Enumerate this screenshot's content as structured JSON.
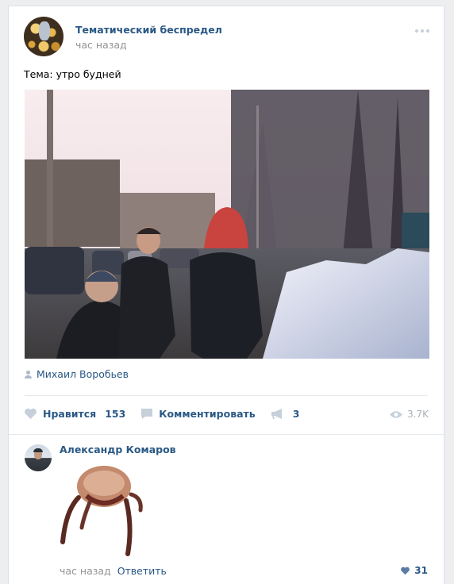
{
  "post": {
    "author": "Тематический беспредел",
    "time": "час назад",
    "text": "Тема: утро будней",
    "photo_author": "Михаил Воробьев",
    "likes_label": "Нравится",
    "likes_count": "153",
    "comment_label": "Комментировать",
    "shares_count": "3",
    "views": "3.7K"
  },
  "comment": {
    "author": "Александр Комаров",
    "time": "час назад",
    "reply_label": "Ответить",
    "likes": "31"
  },
  "colors": {
    "link": "#2a5885",
    "muted": "#939393",
    "icon": "#c5d0db"
  },
  "icons": [
    "more-icon",
    "person-icon",
    "heart-icon",
    "comment-icon",
    "megaphone-icon",
    "eye-icon",
    "heart-small-icon"
  ]
}
